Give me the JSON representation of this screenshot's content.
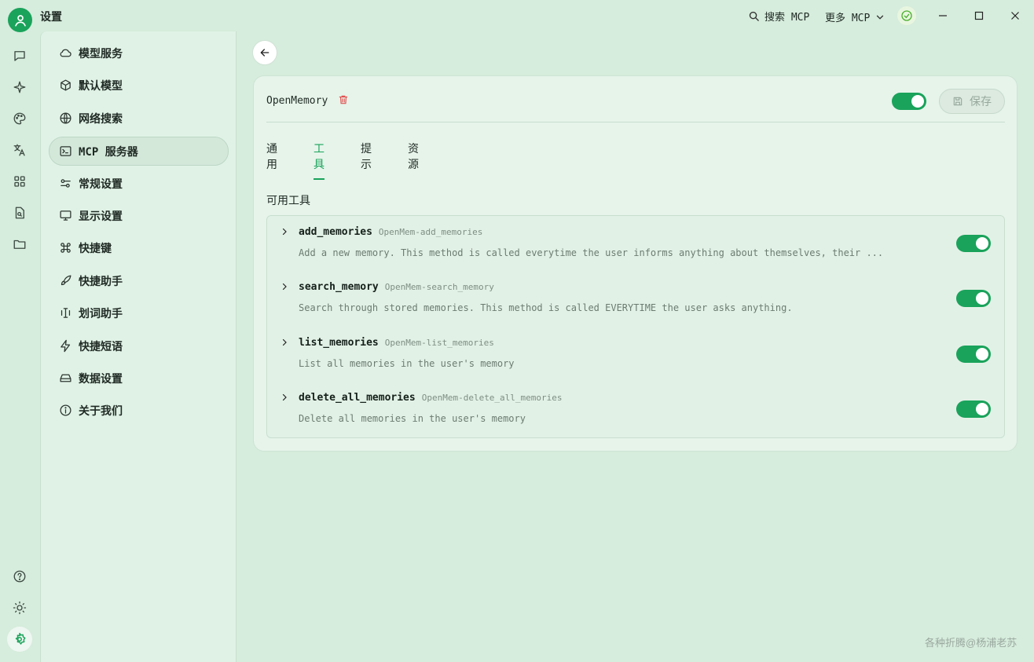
{
  "titlebar": {
    "title": "设置",
    "search_label": "搜索 MCP",
    "more_label": "更多 MCP"
  },
  "sidebar": {
    "items": [
      {
        "label": "模型服务",
        "icon": "cloud-icon"
      },
      {
        "label": "默认模型",
        "icon": "cube-icon"
      },
      {
        "label": "网络搜索",
        "icon": "globe-icon"
      },
      {
        "label": "MCP 服务器",
        "icon": "terminal-icon",
        "active": true
      },
      {
        "label": "常规设置",
        "icon": "sliders-icon"
      },
      {
        "label": "显示设置",
        "icon": "monitor-icon"
      },
      {
        "label": "快捷键",
        "icon": "command-icon"
      },
      {
        "label": "快捷助手",
        "icon": "rocket-icon"
      },
      {
        "label": "划词助手",
        "icon": "text-cursor-icon"
      },
      {
        "label": "快捷短语",
        "icon": "zap-icon"
      },
      {
        "label": "数据设置",
        "icon": "hard-drive-icon"
      },
      {
        "label": "关于我们",
        "icon": "info-icon"
      }
    ]
  },
  "server": {
    "name": "OpenMemory",
    "enabled": true,
    "save_label": "保存"
  },
  "tabs": [
    {
      "label": "通用"
    },
    {
      "label": "工具",
      "active": true
    },
    {
      "label": "提示"
    },
    {
      "label": "资源"
    }
  ],
  "tools_section": {
    "title": "可用工具",
    "tools": [
      {
        "name": "add_memories",
        "id": "OpenMem-add_memories",
        "description": "Add a new memory. This method is called everytime the user informs anything about themselves, their ...",
        "enabled": true
      },
      {
        "name": "search_memory",
        "id": "OpenMem-search_memory",
        "description": "Search through stored memories. This method is called EVERYTIME the user asks anything.",
        "enabled": true
      },
      {
        "name": "list_memories",
        "id": "OpenMem-list_memories",
        "description": "List all memories in the user's memory",
        "enabled": true
      },
      {
        "name": "delete_all_memories",
        "id": "OpenMem-delete_all_memories",
        "description": "Delete all memories in the user's memory",
        "enabled": true
      }
    ]
  },
  "watermark": "各种折腾@杨浦老苏",
  "colors": {
    "accent": "#1aa35b",
    "danger": "#e05252",
    "background": "#d6ecdc"
  }
}
